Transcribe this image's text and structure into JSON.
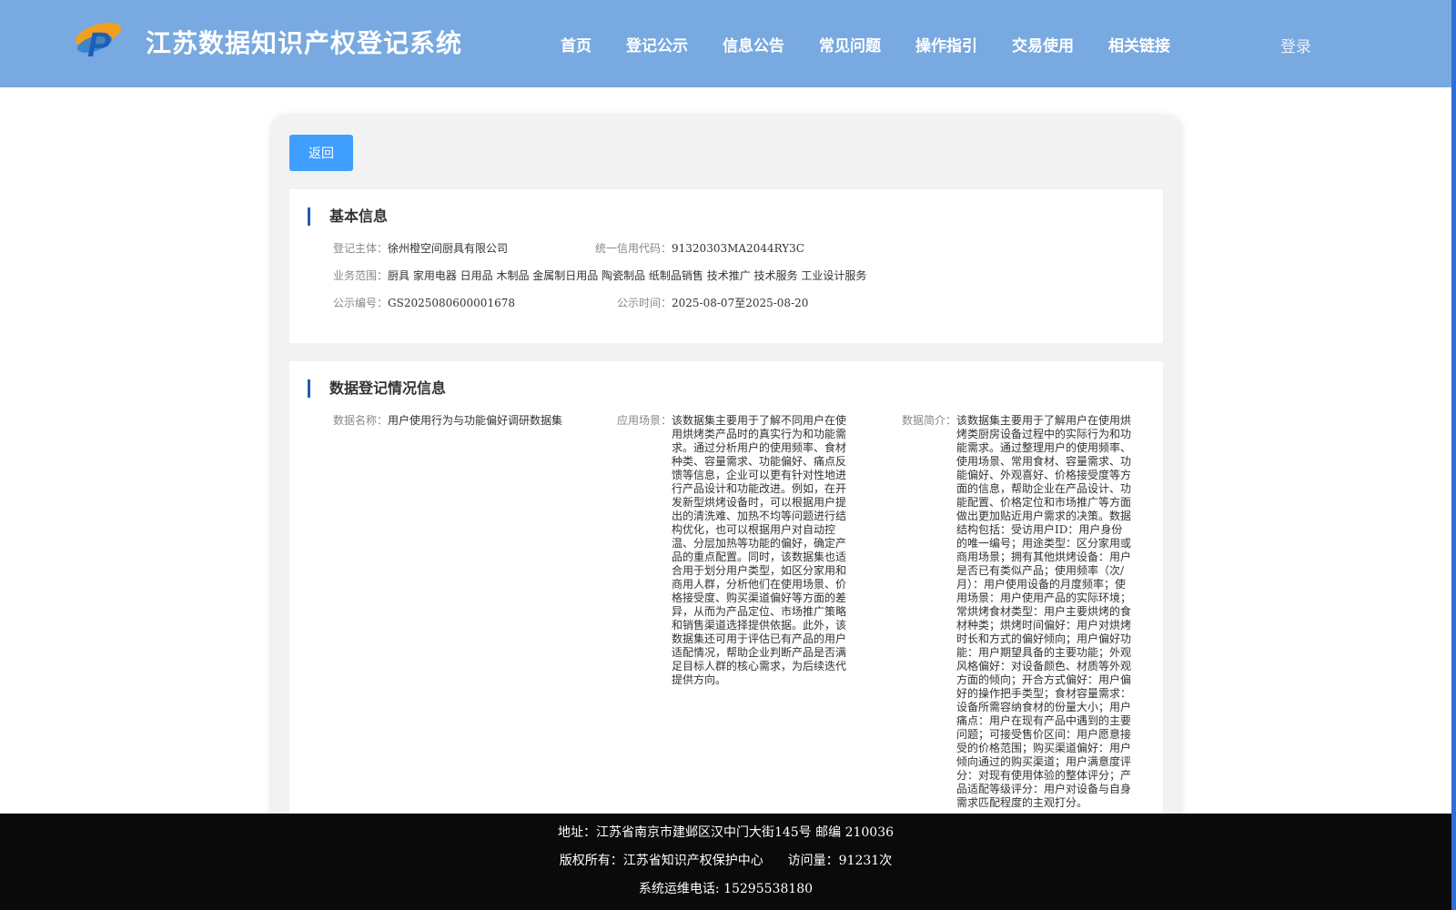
{
  "header": {
    "logo_icon": "cp-logo-icon",
    "title": "江苏数据知识产权登记系统",
    "nav": [
      "首页",
      "登记公示",
      "信息公告",
      "常见问题",
      "操作指引",
      "交易使用",
      "相关链接"
    ],
    "login": "登录",
    "colors": {
      "header_bg": "#78a9e0",
      "accent": "#409eff"
    }
  },
  "toolbar": {
    "back_label": "返回"
  },
  "basic": {
    "title": "基本信息",
    "subject_label": "登记主体：",
    "subject_value": "徐州橙空间厨具有限公司",
    "credit_label": "统一信用代码：",
    "credit_value": "91320303MA2044RY3C",
    "scope_label": "业务范围：",
    "scope_value": "厨具 家用电器 日用品 木制品 金属制日用品 陶瓷制品 纸制品销售 技术推广 技术服务 工业设计服务",
    "pub_no_label": "公示编号：",
    "pub_no_value": "GS2025080600001678",
    "pub_time_label": "公示时间：",
    "pub_time_value": "2025-08-07至2025-08-20"
  },
  "data_reg": {
    "title": "数据登记情况信息",
    "name_label": "数据名称：",
    "name_value": "用户使用行为与功能偏好调研数据集",
    "scenario_label": "应用场景：",
    "scenario_value": "该数据集主要用于了解不同用户在使用烘烤类产品时的真实行为和功能需求。通过分析用户的使用频率、食材种类、容量需求、功能偏好、痛点反馈等信息，企业可以更有针对性地进行产品设计和功能改进。例如，在开发新型烘烤设备时，可以根据用户提出的清洗难、加热不均等问题进行结构优化，也可以根据用户对自动控温、分层加热等功能的偏好，确定产品的重点配置。同时，该数据集也适合用于划分用户类型，如区分家用和商用人群，分析他们在使用场景、价格接受度、购买渠道偏好等方面的差异，从而为产品定位、市场推广策略和销售渠道选择提供依据。此外，该数据集还可用于评估已有产品的用户适配情况，帮助企业判断产品是否满足目标人群的核心需求，为后续迭代提供方向。",
    "intro_label": "数据简介：",
    "intro_value": "该数据集主要用于了解用户在使用烘烤类厨房设备过程中的实际行为和功能需求。通过整理用户的使用频率、使用场景、常用食材、容量需求、功能偏好、外观喜好、价格接受度等方面的信息，帮助企业在产品设计、功能配置、价格定位和市场推广等方面做出更加贴近用户需求的决策。数据结构包括：受访用户ID：用户身份的唯一编号；用途类型：区分家用或商用场景；拥有其他烘烤设备：用户是否已有类似产品；使用频率（次/月）：用户使用设备的月度频率；使用场景：用户使用产品的实际环境；常烘烤食材类型：用户主要烘烤的食材种类；烘烤时间偏好：用户对烘烤时长和方式的偏好倾向；用户偏好功能：用户期望具备的主要功能；外观风格偏好：对设备颜色、材质等外观方面的倾向；开合方式偏好：用户偏好的操作把手类型；食材容量需求：设备所需容纳食材的份量大小；用户痛点：用户在现有产品中遇到的主要问题；可接受售价区间：用户愿意接受的价格范围；购买渠道偏好：用户倾向通过的购买渠道；用户满意度评分：对现有使用体验的整体评分；产品适配等级评分：用户对设备与自身需求匹配程度的主观打分。"
  },
  "footer": {
    "address": "地址：江苏省南京市建邺区汉中门大街145号 邮编 210036",
    "copyright": "版权所有：江苏省知识产权保护中心",
    "visits": "访问量：91231次",
    "phone": "系统运维电话: 15295538180"
  }
}
